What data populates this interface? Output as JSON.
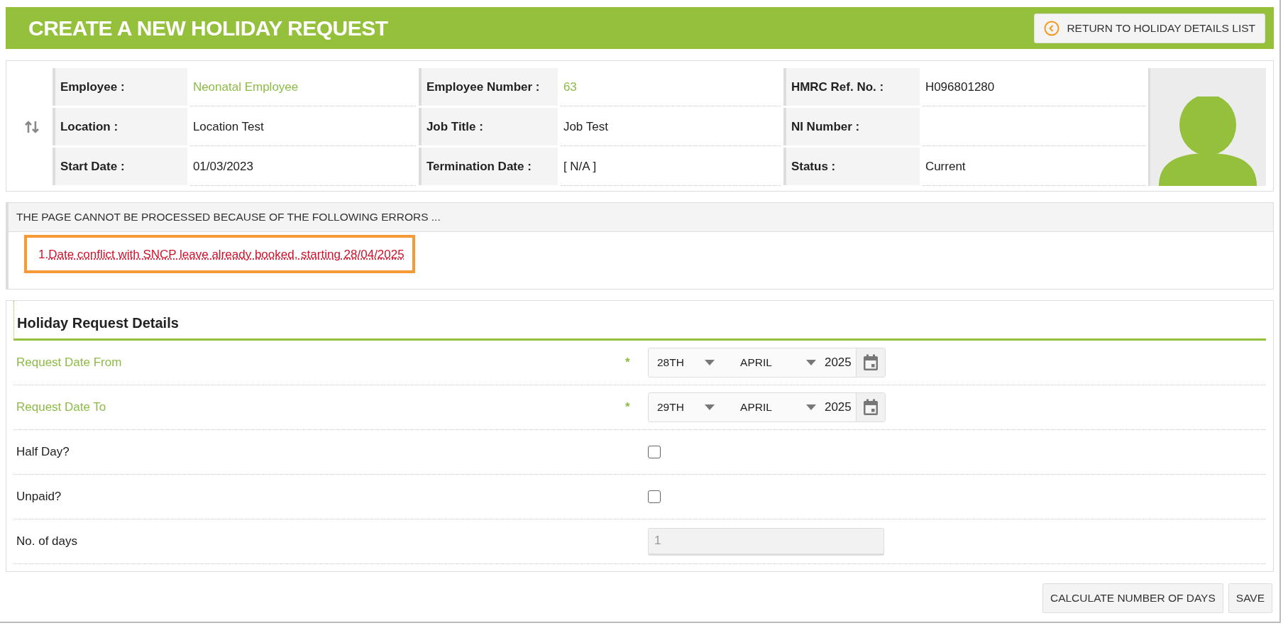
{
  "header": {
    "title": "CREATE A NEW HOLIDAY REQUEST",
    "return_button": "RETURN TO HOLIDAY DETAILS LIST"
  },
  "employee": {
    "fields": [
      {
        "label": "Employee :",
        "value": "Neonatal Employee",
        "link": true
      },
      {
        "label": "Employee Number :",
        "value": "63",
        "link": true
      },
      {
        "label": "HMRC Ref. No. :",
        "value": "H096801280",
        "link": false
      },
      {
        "label": "Location :",
        "value": "Location Test",
        "link": false
      },
      {
        "label": "Job Title :",
        "value": "Job Test",
        "link": false
      },
      {
        "label": "NI Number :"
      },
      {
        "label": "Start Date :",
        "value": "01/03/2023",
        "link": false
      },
      {
        "label": "Termination Date :",
        "value": "[ N/A ]",
        "link": false
      },
      {
        "label": "Status :",
        "value": "Current",
        "link": false
      }
    ]
  },
  "errors": {
    "heading": "THE PAGE CANNOT BE PROCESSED BECAUSE OF THE FOLLOWING ERRORS ...",
    "items": [
      {
        "number": "1.",
        "text": "Date conflict with SNCP leave already booked, starting 28/04/2025",
        "highlighted": true
      }
    ]
  },
  "details": {
    "title": "Holiday Request Details",
    "rows": [
      {
        "kind": "date",
        "label": "Request Date From",
        "required": true,
        "required_mark": "*",
        "day": "28TH",
        "month": "APRIL",
        "year": "2025"
      },
      {
        "kind": "date",
        "label": "Request Date To",
        "required": true,
        "required_mark": "*",
        "day": "29TH",
        "month": "APRIL",
        "year": "2025"
      },
      {
        "kind": "checkbox",
        "label": "Half Day?",
        "required": false,
        "checked": false
      },
      {
        "kind": "checkbox",
        "label": "Unpaid?",
        "required": false,
        "checked": false
      },
      {
        "kind": "number",
        "label": "No. of days",
        "required": false,
        "value": "1",
        "disabled": true
      }
    ]
  },
  "buttons": [
    "CALCULATE NUMBER OF DAYS",
    "SAVE"
  ]
}
